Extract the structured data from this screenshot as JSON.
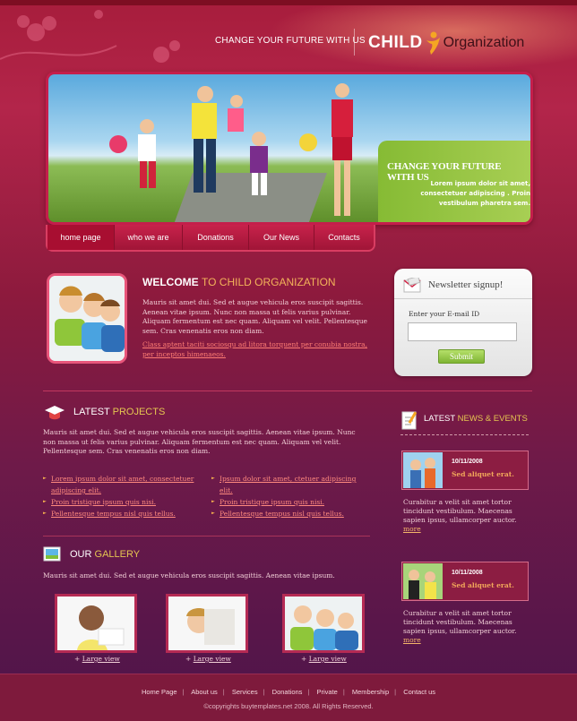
{
  "header": {
    "tagline": "CHANGE YOUR FUTURE WITH US",
    "logo_child": "CHILD",
    "logo_org": "Organization"
  },
  "banner": {
    "title": "CHANGE YOUR FUTURE WITH US",
    "text": "Lorem ipsum dolor sit amet, consectetuer adipiscing . Proin vestibulum pharetra sem."
  },
  "nav": {
    "items": [
      {
        "label": "home page",
        "active": true
      },
      {
        "label": "who we are",
        "active": false
      },
      {
        "label": "Donations",
        "active": false
      },
      {
        "label": "Our News",
        "active": false
      },
      {
        "label": "Contacts",
        "active": false
      }
    ]
  },
  "welcome": {
    "title_main": "WELCOME",
    "title_accent": "TO CHILD ORGANIZATION",
    "text": "Mauris sit amet dui. Sed et augue vehicula eros suscipit sagittis. Aenean vitae ipsum. Nunc non massa ut felis varius pulvinar. Aliquam fermentum est nec quam. Aliquam vel velit. Pellentesque sem. Cras venenatis eros non diam.",
    "link": "Class aptent taciti sociosqu ad litora torquent per conubia nostra, per inceptos himenaeos."
  },
  "newsletter": {
    "title": "Newsletter signup!",
    "label": "Enter your E-mail ID",
    "value": "",
    "submit": "Submit"
  },
  "projects": {
    "title_main": "LATEST",
    "title_accent": "PROJECTS",
    "text": "Mauris sit amet dui. Sed et augue vehicula eros suscipit sagittis. Aenean vitae ipsum. Nunc non massa ut felis varius pulvinar. Aliquam fermentum est nec quam. Aliquam vel velit. Pellentesque sem. Cras venenatis eros non diam.",
    "left_links": [
      "Lorem ipsum dolor sit amet, consectetuer adipiscing elit.",
      "Proin tristique ipsum quis nisi.",
      "Pellentesque tempus nisl quis tellus."
    ],
    "right_links": [
      "Ipsum dolor sit amet, ctetuer adipiscing elit.",
      "Proin tristique ipsum quis nisi.",
      "Pellentesque tempus nisl quis tellus."
    ]
  },
  "gallery": {
    "title_main": "OUR",
    "title_accent": "GALLERY",
    "text": "Mauris sit amet dui. Sed et augue vehicula eros suscipit sagittis. Aenean vitae ipsum.",
    "plus": "+",
    "view_label": "Large view"
  },
  "news": {
    "title_main": "LATEST",
    "title_accent": "NEWS & EVENTS",
    "items": [
      {
        "date": "10/11/2008",
        "headline": "Sed aliquet erat.",
        "text": "Curabitur a velit sit amet tortor tincidunt vestibulum. Maecenas sapien ipsus, ullamcorper auctor.",
        "more": "more"
      },
      {
        "date": "10/11/2008",
        "headline": "Sed aliquet erat.",
        "text": "Curabitur a velit sit amet tortor tincidunt vestibulum. Maecenas sapien ipsus, ullamcorper auctor.",
        "more": "more"
      }
    ]
  },
  "footer": {
    "links": [
      "Home Page",
      "About us",
      "Services",
      "Donations",
      "Private",
      "Membership",
      "Contact us"
    ],
    "separator": "|",
    "copyright": "©copyrights buytemplates.net 2008. All Rights Reserved."
  },
  "colors": {
    "background": "#a71d3c",
    "nav": "#c8224b",
    "accent_orange": "#f3b35a",
    "accent_yellow": "#e5c651",
    "banner_green": "#86bb34",
    "footer": "#7e1a3c"
  },
  "icons": {
    "logo": "figure-logo-icon",
    "newsletter": "envelope-icon",
    "projects": "cap-icon",
    "gallery": "photo-icon",
    "news": "notepad-icon",
    "bullet": "triangle-bullet-icon"
  }
}
